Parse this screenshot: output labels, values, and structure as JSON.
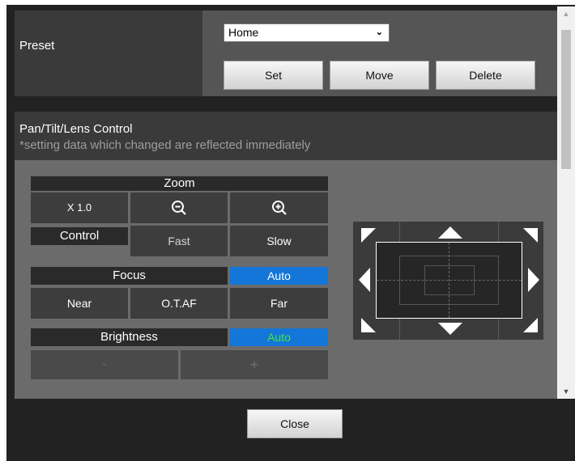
{
  "preset": {
    "label": "Preset",
    "selected": "Home",
    "set_label": "Set",
    "move_label": "Move",
    "delete_label": "Delete"
  },
  "pan_tilt": {
    "title": "Pan/Tilt/Lens Control",
    "subtitle": "*setting data which changed are reflected immediately"
  },
  "zoom": {
    "header": "Zoom",
    "value": "X 1.0",
    "control_label": "Control",
    "fast_label": "Fast",
    "slow_label": "Slow"
  },
  "focus": {
    "header": "Focus",
    "auto_label": "Auto",
    "near_label": "Near",
    "otaf_label": "O.T.AF",
    "far_label": "Far"
  },
  "brightness": {
    "header": "Brightness",
    "auto_label": "Auto",
    "minus_label": "-",
    "plus_label": "+"
  },
  "footer": {
    "close_label": "Close"
  },
  "colors": {
    "accent_blue": "#1476d8",
    "auto_green": "#48e648"
  },
  "icons": [
    "zoom-out-icon",
    "zoom-in-icon",
    "chevron-down-icon",
    "arrow-up-icon",
    "arrow-down-icon",
    "arrow-left-icon",
    "arrow-right-icon"
  ]
}
